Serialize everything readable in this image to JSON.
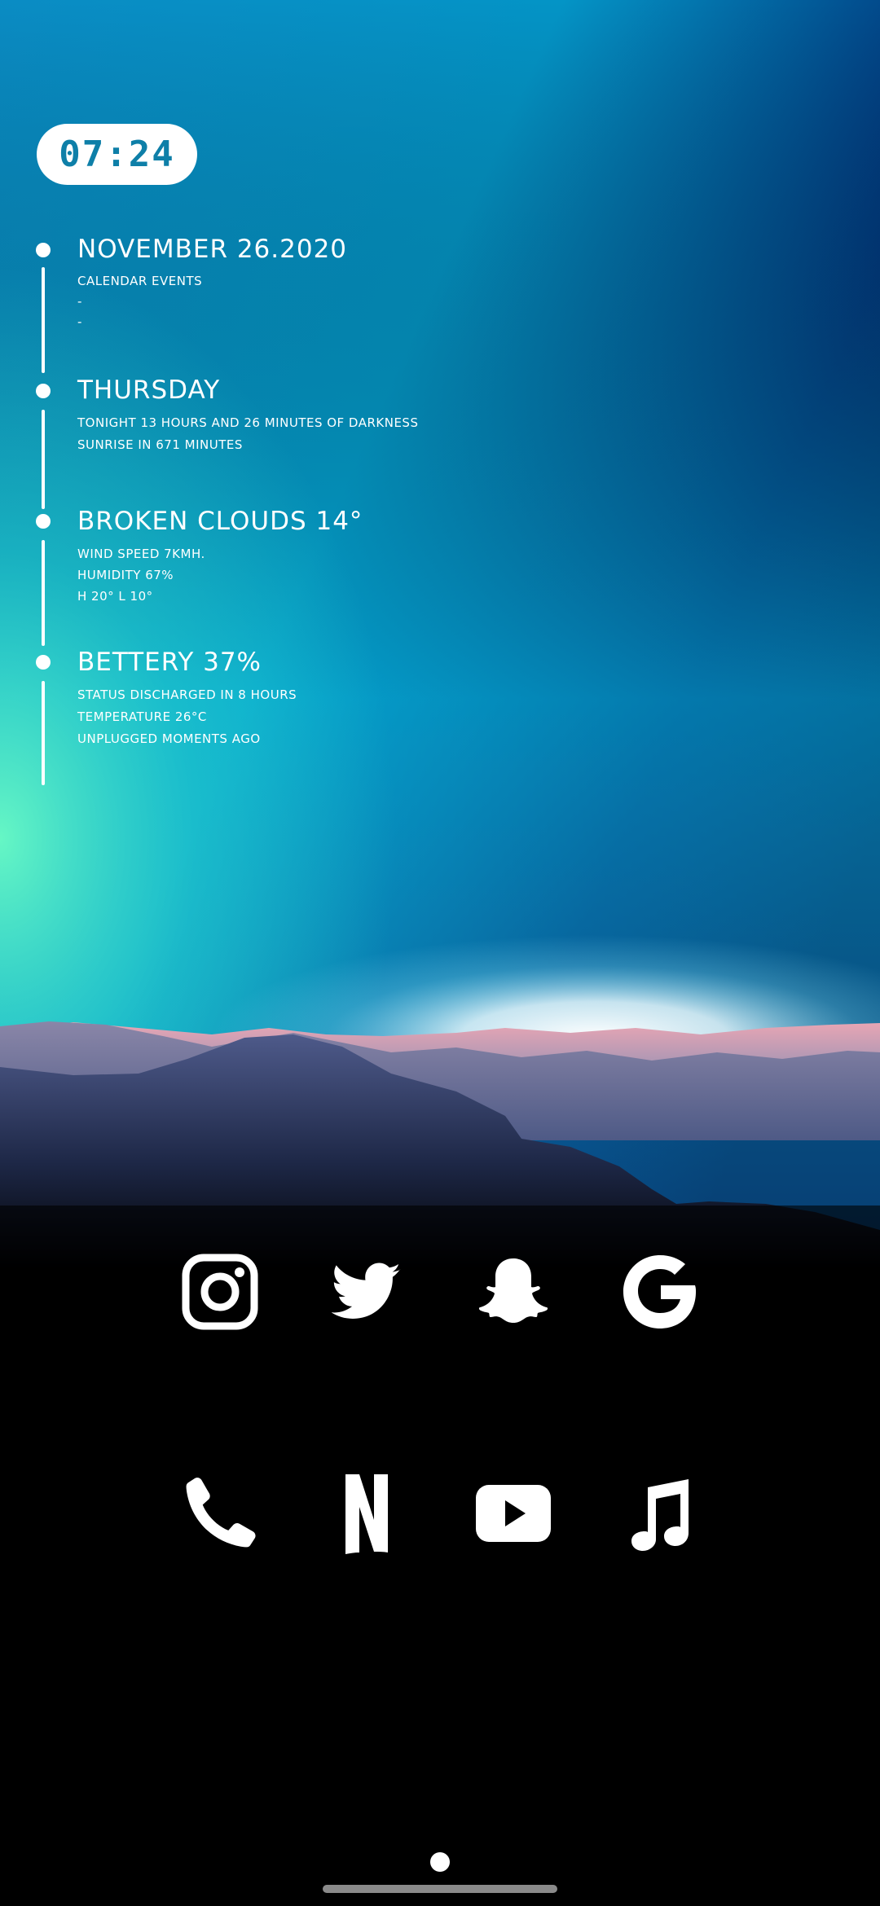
{
  "clock": {
    "time": "07:24"
  },
  "timeline": [
    {
      "title": "NOVEMBER 26.2020",
      "lines": [
        "CALENDAR EVENTS",
        "-",
        "-"
      ]
    },
    {
      "title": "THURSDAY",
      "lines": [
        "TONIGHT 13 HOURS AND 26 MINUTES OF DARKNESS",
        "SUNRISE IN 671 MINUTES"
      ]
    },
    {
      "title": "BROKEN CLOUDS 14°",
      "lines": [
        "WIND SPEED 7KMH.",
        "HUMIDITY 67%",
        "H 20° L 10°"
      ]
    },
    {
      "title": "BETTERY 37%",
      "lines": [
        "STATUS DISCHARGED IN 8 HOURS",
        "TEMPERATURE 26°C",
        "UNPLUGGED MOMENTS AGO"
      ]
    }
  ],
  "apps": {
    "row1": [
      "instagram-icon",
      "twitter-icon",
      "snapchat-icon",
      "google-icon"
    ],
    "row2": [
      "phone-icon",
      "netflix-icon",
      "youtube-icon",
      "music-icon"
    ]
  },
  "colors": {
    "sky_top": "#00215f",
    "sky_mid": "#03a9cf",
    "glow": "#ffffff",
    "clock_text": "#0e7fa8",
    "background": "#000000"
  }
}
